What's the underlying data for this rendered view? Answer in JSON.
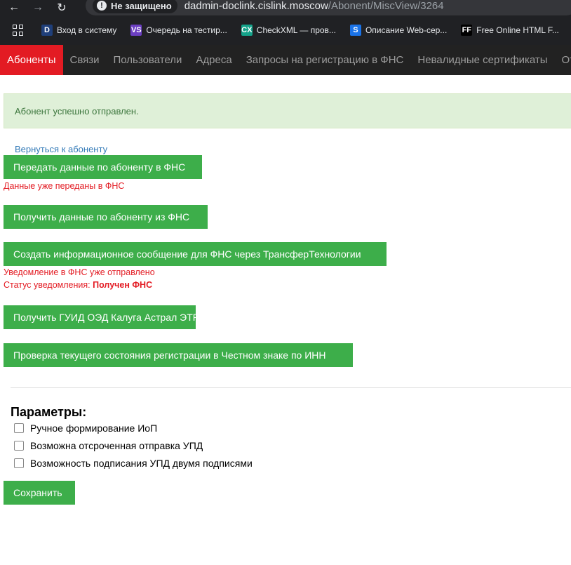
{
  "browser": {
    "security_label": "Не защищено",
    "url_host": "dadmin-doclink.cislink.moscow",
    "url_path": "/Abonent/MiscView/3264",
    "bookmarks": [
      {
        "icon": "D",
        "label": "Вход в систему"
      },
      {
        "icon": "VS",
        "label": "Очередь на тестир..."
      },
      {
        "icon": "CX",
        "label": "CheckXML — пров..."
      },
      {
        "icon": "S",
        "label": "Описание Web-сер..."
      },
      {
        "icon": "FF",
        "label": "Free Online HTML F..."
      }
    ]
  },
  "nav": {
    "tabs": [
      {
        "label": "Абоненты",
        "active": true
      },
      {
        "label": "Связи"
      },
      {
        "label": "Пользователи"
      },
      {
        "label": "Адреса"
      },
      {
        "label": "Запросы на регистрацию в ФНС"
      },
      {
        "label": "Невалидные сертификаты"
      },
      {
        "label": "Отче"
      }
    ]
  },
  "alert": {
    "text": "Абонент успешно отправлен."
  },
  "actions": {
    "back_link": "Вернуться к абоненту",
    "send_fns": "Передать данные по абоненту в ФНС",
    "send_fns_note": "Данные уже переданы в ФНС",
    "get_fns": "Получить данные по абоненту из ФНС",
    "create_msg": "Создать информационное сообщение для ФНС через ТрансферТехнологии",
    "create_msg_note": "Уведомление в ФНС уже отправлено",
    "status_label": "Статус уведомления: ",
    "status_value": "Получен ФНС",
    "get_guid": "Получить ГУИД ОЭД Калуга Астрал ЭТРН",
    "check_chz": "Проверка текущего состояния регистрации в Честном знаке по ИНН"
  },
  "params": {
    "title": "Параметры:",
    "options": [
      {
        "label": "Ручное формирование ИоП",
        "checked": false
      },
      {
        "label": "Возможна отсроченная отправка УПД",
        "checked": false
      },
      {
        "label": "Возможность подписания УПД двумя подписями",
        "checked": false
      }
    ],
    "save": "Сохранить"
  }
}
